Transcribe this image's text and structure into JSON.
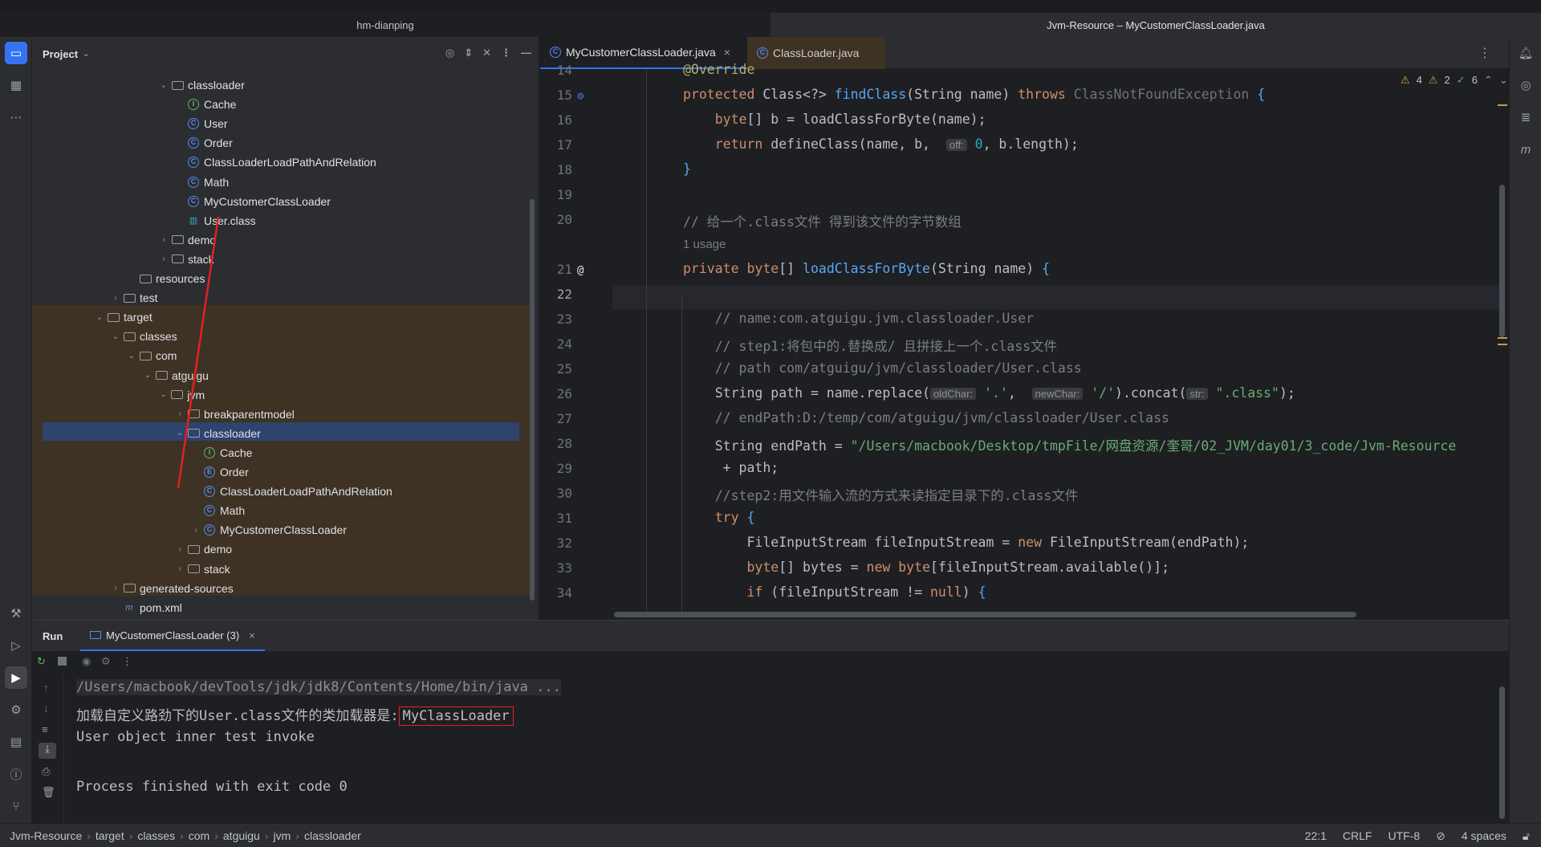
{
  "window": {
    "left_title": "hm-dianping",
    "right_title": "Jvm-Resource – MyCustomerClassLoader.java"
  },
  "project": {
    "header": "Project",
    "rows": [
      {
        "label": "classloader",
        "kind": "folder",
        "indent": 1,
        "chev": "⌄"
      },
      {
        "label": "Cache",
        "kind": "interface",
        "indent": 2,
        "chev": ""
      },
      {
        "label": "User",
        "kind": "class",
        "indent": 2,
        "chev": ""
      },
      {
        "label": "Order",
        "kind": "class",
        "indent": 2,
        "chev": ""
      },
      {
        "label": "ClassLoaderLoadPathAndRelation",
        "kind": "class",
        "indent": 2,
        "chev": ""
      },
      {
        "label": "Math",
        "kind": "class",
        "indent": 2,
        "chev": ""
      },
      {
        "label": "MyCustomerClassLoader",
        "kind": "class",
        "indent": 2,
        "chev": ""
      },
      {
        "label": "User.class",
        "kind": "classfile",
        "indent": 2,
        "chev": ""
      },
      {
        "label": "demo",
        "kind": "folder",
        "indent": 1,
        "chev": "›"
      },
      {
        "label": "stack",
        "kind": "folder",
        "indent": 1,
        "chev": "›"
      },
      {
        "label": "resources",
        "kind": "folder",
        "indent": -1,
        "chev": ""
      },
      {
        "label": "test",
        "kind": "folder",
        "indent": -2,
        "chev": "›"
      },
      {
        "label": "target",
        "kind": "folder",
        "indent": -3,
        "chev": "⌄"
      },
      {
        "label": "classes",
        "kind": "folder",
        "indent": -2,
        "chev": "⌄"
      },
      {
        "label": "com",
        "kind": "folder",
        "indent": -1,
        "chev": "⌄"
      },
      {
        "label": "atguigu",
        "kind": "folder",
        "indent": 0,
        "chev": "⌄"
      },
      {
        "label": "jvm",
        "kind": "folder",
        "indent": 0.97,
        "chev": "⌄"
      },
      {
        "label": "breakparentmodel",
        "kind": "folder",
        "indent": 2,
        "chev": "›"
      },
      {
        "label": "classloader",
        "kind": "folder",
        "indent": 2,
        "chev": "⌄"
      },
      {
        "label": "Cache",
        "kind": "interface",
        "indent": 3,
        "chev": ""
      },
      {
        "label": "Order",
        "kind": "enum",
        "indent": 3,
        "chev": ""
      },
      {
        "label": "ClassLoaderLoadPathAndRelation",
        "kind": "class",
        "indent": 3,
        "chev": ""
      },
      {
        "label": "Math",
        "kind": "class",
        "indent": 3,
        "chev": ""
      },
      {
        "label": "MyCustomerClassLoader",
        "kind": "class",
        "indent": 3,
        "chev": "›"
      },
      {
        "label": "demo",
        "kind": "folder",
        "indent": 2,
        "chev": "›"
      },
      {
        "label": "stack",
        "kind": "folder",
        "indent": 2,
        "chev": "›"
      },
      {
        "label": "generated-sources",
        "kind": "folder",
        "indent": -2,
        "chev": "›"
      },
      {
        "label": "pom.xml",
        "kind": "maven",
        "indent": -2,
        "chev": ""
      }
    ]
  },
  "editor": {
    "tabs": [
      "MyCustomerClassLoader.java",
      "ClassLoader.java"
    ],
    "inspections": {
      "warn": "4",
      "weak": "2",
      "ok": "6"
    },
    "line_numbers": [
      "14",
      "15",
      "16",
      "17",
      "18",
      "19",
      "20",
      "",
      "21",
      "22",
      "23",
      "24",
      "25",
      "26",
      "27",
      "28",
      "29",
      "30",
      "31",
      "32",
      "33",
      "34"
    ],
    "usage": "1 usage"
  },
  "run": {
    "title": "Run",
    "tab": "MyCustomerClassLoader (3)",
    "lines": [
      "/Users/macbook/devTools/jdk/jdk8/Contents/Home/bin/java ...",
      "加载自定义路劲下的User.class文件的类加载器是:",
      "MyClassLoader",
      "User object inner test invoke",
      "",
      "Process finished with exit code 0"
    ]
  },
  "status": {
    "crumbs": [
      "Jvm-Resource",
      "target",
      "classes",
      "com",
      "atguigu",
      "jvm",
      "classloader"
    ],
    "position": "22:1",
    "line_sep": "CRLF",
    "encoding": "UTF-8",
    "indent": "4 spaces"
  }
}
